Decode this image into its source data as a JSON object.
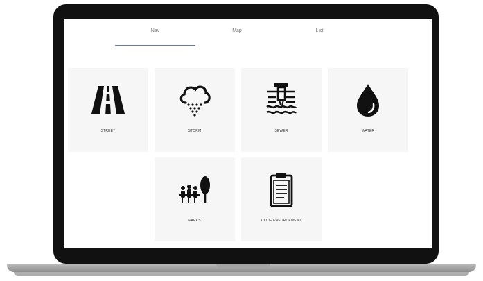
{
  "tabs": [
    {
      "label": "Nav",
      "active": true
    },
    {
      "label": "Map",
      "active": false
    },
    {
      "label": "List",
      "active": false
    }
  ],
  "tiles": [
    {
      "label": "STREET",
      "icon": "road-icon"
    },
    {
      "label": "STORM",
      "icon": "storm-cloud-icon"
    },
    {
      "label": "SEWER",
      "icon": "sewer-icon"
    },
    {
      "label": "WATER",
      "icon": "water-drop-icon"
    },
    {
      "label": "PARKS",
      "icon": "parks-icon"
    },
    {
      "label": "CODE ENFORCEMENT",
      "icon": "clipboard-icon"
    }
  ],
  "colors": {
    "frame": "#111111",
    "tile": "#f6f6f6",
    "tab_underline": "#6a7aa8"
  }
}
